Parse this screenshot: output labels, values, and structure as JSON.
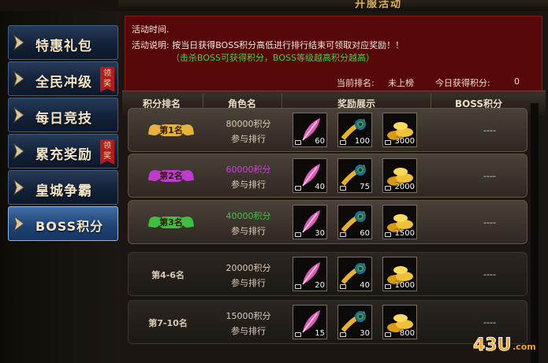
{
  "window": {
    "title": "开服活动"
  },
  "sidebar": {
    "items": [
      {
        "label": "特惠礼包",
        "ribbon": ""
      },
      {
        "label": "全民冲级",
        "ribbon": "领奖"
      },
      {
        "label": "每日竞技",
        "ribbon": ""
      },
      {
        "label": "累充奖励",
        "ribbon": "领奖"
      },
      {
        "label": "皇城争霸",
        "ribbon": ""
      },
      {
        "label": "BOSS积分",
        "ribbon": ""
      }
    ],
    "active_index": 5
  },
  "info": {
    "time_label": "活动时间.",
    "desc": "活动说明: 按当日获得BOSS积分高低进行排行结束可领取对应奖励！！",
    "hint": "（击杀BOSS可获得积分，BOSS等级越高积分越高）",
    "rank_label": "当前排名:",
    "rank_value": "未上榜",
    "today_label": "今日获得积分:",
    "today_value": "0"
  },
  "table": {
    "headers": [
      "积分排名",
      "角色名",
      "奖励展示",
      "BOSS积分"
    ],
    "rows": [
      {
        "rank": "第1名",
        "tier": "gold",
        "points": "80000积分",
        "join": "参与排行",
        "rewards": [
          "60",
          "100",
          "3000"
        ],
        "boss": "----"
      },
      {
        "rank": "第2名",
        "tier": "purple",
        "points": "60000积分",
        "join": "参与排行",
        "rewards": [
          "40",
          "75",
          "2000"
        ],
        "boss": "----"
      },
      {
        "rank": "第3名",
        "tier": "green",
        "points": "40000积分",
        "join": "参与排行",
        "rewards": [
          "30",
          "60",
          "1500"
        ],
        "boss": "----"
      },
      {
        "rank": "第4-6名",
        "tier": "plain",
        "points": "20000积分",
        "join": "参与排行",
        "rewards": [
          "20",
          "40",
          "1000"
        ],
        "boss": "----"
      },
      {
        "rank": "第7-10名",
        "tier": "plain",
        "points": "15000积分",
        "join": "参与排行",
        "rewards": [
          "15",
          "30",
          "800"
        ],
        "boss": "----"
      }
    ],
    "reward_icons": [
      "feather-icon",
      "peacock-feather-icon",
      "gold-ingot-icon"
    ]
  },
  "colors": {
    "gold": "#e6b33a",
    "purple": "#c03ad0",
    "green": "#3fbf3f",
    "points_gold": "#d8cbb0",
    "points_purple": "#d23ee0",
    "points_green": "#41c640"
  },
  "watermark": {
    "text": "43U.com"
  }
}
